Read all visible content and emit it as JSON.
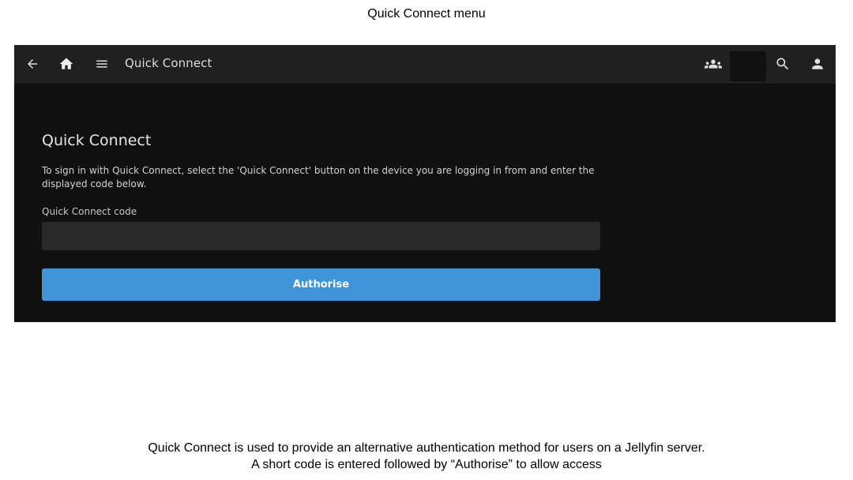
{
  "slide": {
    "title": "Quick Connect menu",
    "caption_line1": "Quick Connect is used to provide an alternative authentication method for users on a Jellyfin server.",
    "caption_line2": "A short code is entered followed by “Authorise” to allow access"
  },
  "header": {
    "title": "Quick Connect",
    "icons": {
      "back": "arrow-left-icon",
      "home": "home-icon",
      "menu": "hamburger-menu-icon",
      "group": "group-users-icon",
      "search": "search-icon",
      "user": "user-icon"
    }
  },
  "main": {
    "heading": "Quick Connect",
    "description": "To sign in with Quick Connect, select the 'Quick Connect' button on the device you are logging in from and enter the displayed code below.",
    "code_label": "Quick Connect code",
    "code_value": "",
    "authorise_label": "Authorise"
  },
  "colors": {
    "header_bg": "#202020",
    "page_bg": "#101010",
    "input_bg": "#292929",
    "accent": "#4095d8"
  }
}
